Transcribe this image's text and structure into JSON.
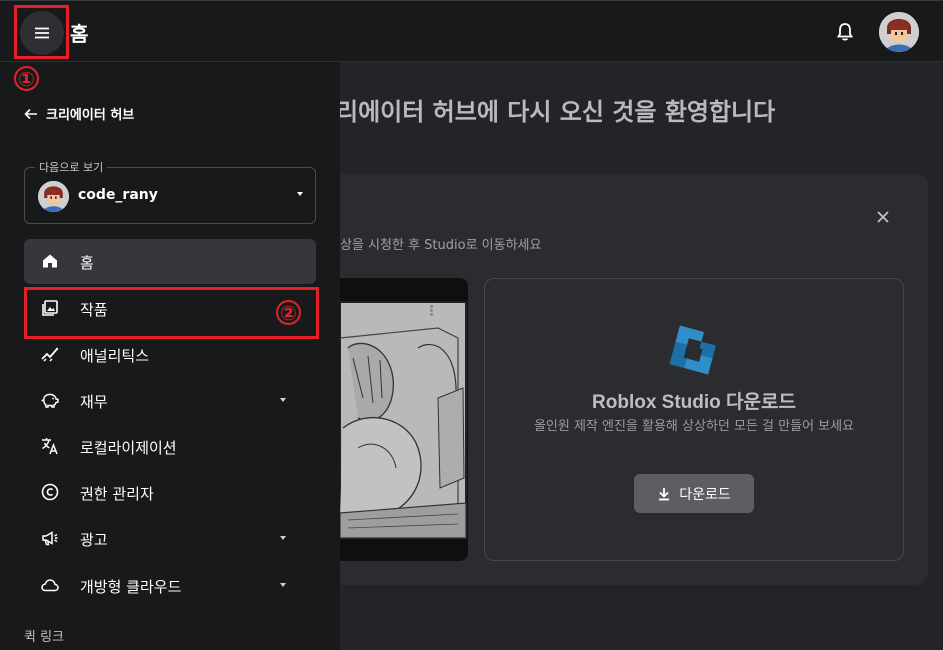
{
  "header": {
    "title": "홈",
    "menu_icon": "hamburger-menu-icon",
    "notification_icon": "bell-icon",
    "profile_icon": "user-avatar"
  },
  "main": {
    "welcome_text": "리에이터 허브에 다시 오신 것을 환영합니다",
    "card": {
      "subtitle": "상을 시청한 후 Studio로 이동하세요",
      "close_icon": "close-icon",
      "video_menu_icon": "more-vertical-icon",
      "download": {
        "title": "Roblox Studio 다운로드",
        "description": "올인원 제작 엔진을 활용해 상상하던 모든 걸 만들어 보세요",
        "button_label": "다운로드",
        "logo_icon": "roblox-studio-logo"
      }
    }
  },
  "sidebar": {
    "back_label": "크리에이터 허브",
    "view_as": {
      "legend": "다음으로 보기",
      "username": "code_rany"
    },
    "items": [
      {
        "label": "홈",
        "icon": "home-icon",
        "active": true
      },
      {
        "label": "작품",
        "icon": "creations-icon",
        "active": false
      },
      {
        "label": "애널리틱스",
        "icon": "analytics-icon",
        "active": false
      },
      {
        "label": "재무",
        "icon": "piggy-bank-icon",
        "active": false
      },
      {
        "label": "로컬라이제이션",
        "icon": "translate-icon",
        "active": false
      },
      {
        "label": "권한 관리자",
        "icon": "copyright-icon",
        "active": false
      },
      {
        "label": "광고",
        "icon": "megaphone-icon",
        "active": false
      },
      {
        "label": "개방형 클라우드",
        "icon": "cloud-icon",
        "active": false
      }
    ],
    "quick_links_label": "퀵 링크"
  },
  "annotations": {
    "callout_1": "①",
    "callout_2": "②",
    "color": "#e4212b"
  }
}
